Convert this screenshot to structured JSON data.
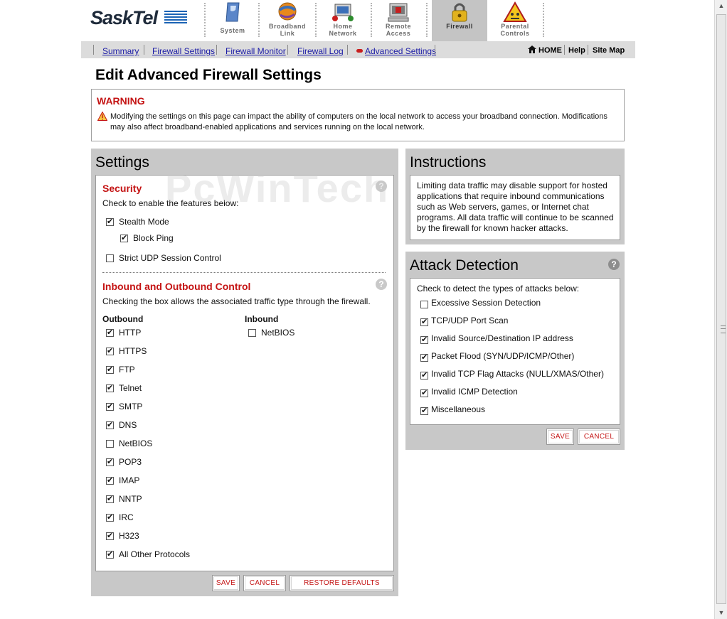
{
  "brand": {
    "name": "SaskTel"
  },
  "top_nav": [
    {
      "label_line1": "System",
      "label_line2": "",
      "icon": "system-icon",
      "active": false
    },
    {
      "label_line1": "Broadband",
      "label_line2": "Link",
      "icon": "globe-icon",
      "active": false
    },
    {
      "label_line1": "Home",
      "label_line2": "Network",
      "icon": "network-icon",
      "active": false
    },
    {
      "label_line1": "Remote",
      "label_line2": "Access",
      "icon": "computer-icon",
      "active": false
    },
    {
      "label_line1": "Firewall",
      "label_line2": "",
      "icon": "lock-icon",
      "active": true
    },
    {
      "label_line1": "Parental",
      "label_line2": "Controls",
      "icon": "caution-icon",
      "active": false
    }
  ],
  "sub_nav": {
    "links": [
      "Summary",
      "Firewall Settings",
      "Firewall Monitor",
      "Firewall Log",
      "Advanced Settings"
    ],
    "home": "HOME",
    "help": "Help",
    "site_map": "Site Map"
  },
  "page_title": "Edit Advanced Firewall Settings",
  "warning": {
    "title": "WARNING",
    "text": "Modifying the settings on this page can impact the ability of computers on the local network to access your broadband connection. Modifications may also affect broadband-enabled applications and services running on the local network."
  },
  "settings": {
    "heading": "Settings",
    "security": {
      "title": "Security",
      "intro": "Check to enable the features below:",
      "stealth_mode": {
        "label": "Stealth Mode",
        "checked": true
      },
      "block_ping": {
        "label": "Block Ping",
        "checked": true
      },
      "strict_udp": {
        "label": "Strict UDP Session Control",
        "checked": false
      }
    },
    "traffic": {
      "title": "Inbound and Outbound Control",
      "intro": "Checking the box allows the associated traffic type through the firewall.",
      "outbound_header": "Outbound",
      "inbound_header": "Inbound",
      "outbound": [
        {
          "label": "HTTP",
          "checked": true
        },
        {
          "label": "HTTPS",
          "checked": true
        },
        {
          "label": "FTP",
          "checked": true
        },
        {
          "label": "Telnet",
          "checked": true
        },
        {
          "label": "SMTP",
          "checked": true
        },
        {
          "label": "DNS",
          "checked": true
        },
        {
          "label": "NetBIOS",
          "checked": false
        },
        {
          "label": "POP3",
          "checked": true
        },
        {
          "label": "IMAP",
          "checked": true
        },
        {
          "label": "NNTP",
          "checked": true
        },
        {
          "label": "IRC",
          "checked": true
        },
        {
          "label": "H323",
          "checked": true
        },
        {
          "label": "All Other Protocols",
          "checked": true
        }
      ],
      "inbound": [
        {
          "label": "NetBIOS",
          "checked": false
        }
      ]
    },
    "buttons": {
      "save": "SAVE",
      "cancel": "CANCEL",
      "restore": "RESTORE DEFAULTS"
    }
  },
  "instructions": {
    "heading": "Instructions",
    "text": "Limiting data traffic may disable support for hosted applications that require inbound communications such as Web servers, games, or Internet chat programs. All data traffic will continue to be scanned by the firewall for known hacker attacks."
  },
  "attack_detection": {
    "heading": "Attack Detection",
    "intro": "Check to detect the types of attacks below:",
    "items": [
      {
        "label": "Excessive Session Detection",
        "checked": false
      },
      {
        "label": "TCP/UDP Port Scan",
        "checked": true
      },
      {
        "label": "Invalid Source/Destination IP address",
        "checked": true
      },
      {
        "label": "Packet Flood (SYN/UDP/ICMP/Other)",
        "checked": true
      },
      {
        "label": "Invalid TCP Flag Attacks (NULL/XMAS/Other)",
        "checked": true
      },
      {
        "label": "Invalid ICMP Detection",
        "checked": true
      },
      {
        "label": "Miscellaneous",
        "checked": true
      }
    ],
    "buttons": {
      "save": "SAVE",
      "cancel": "CANCEL"
    }
  },
  "watermark": "PcWinTech",
  "colors": {
    "accent_red": "#c41414",
    "link_blue": "#1a1aa6",
    "panel_gray": "#c8c8c8"
  }
}
